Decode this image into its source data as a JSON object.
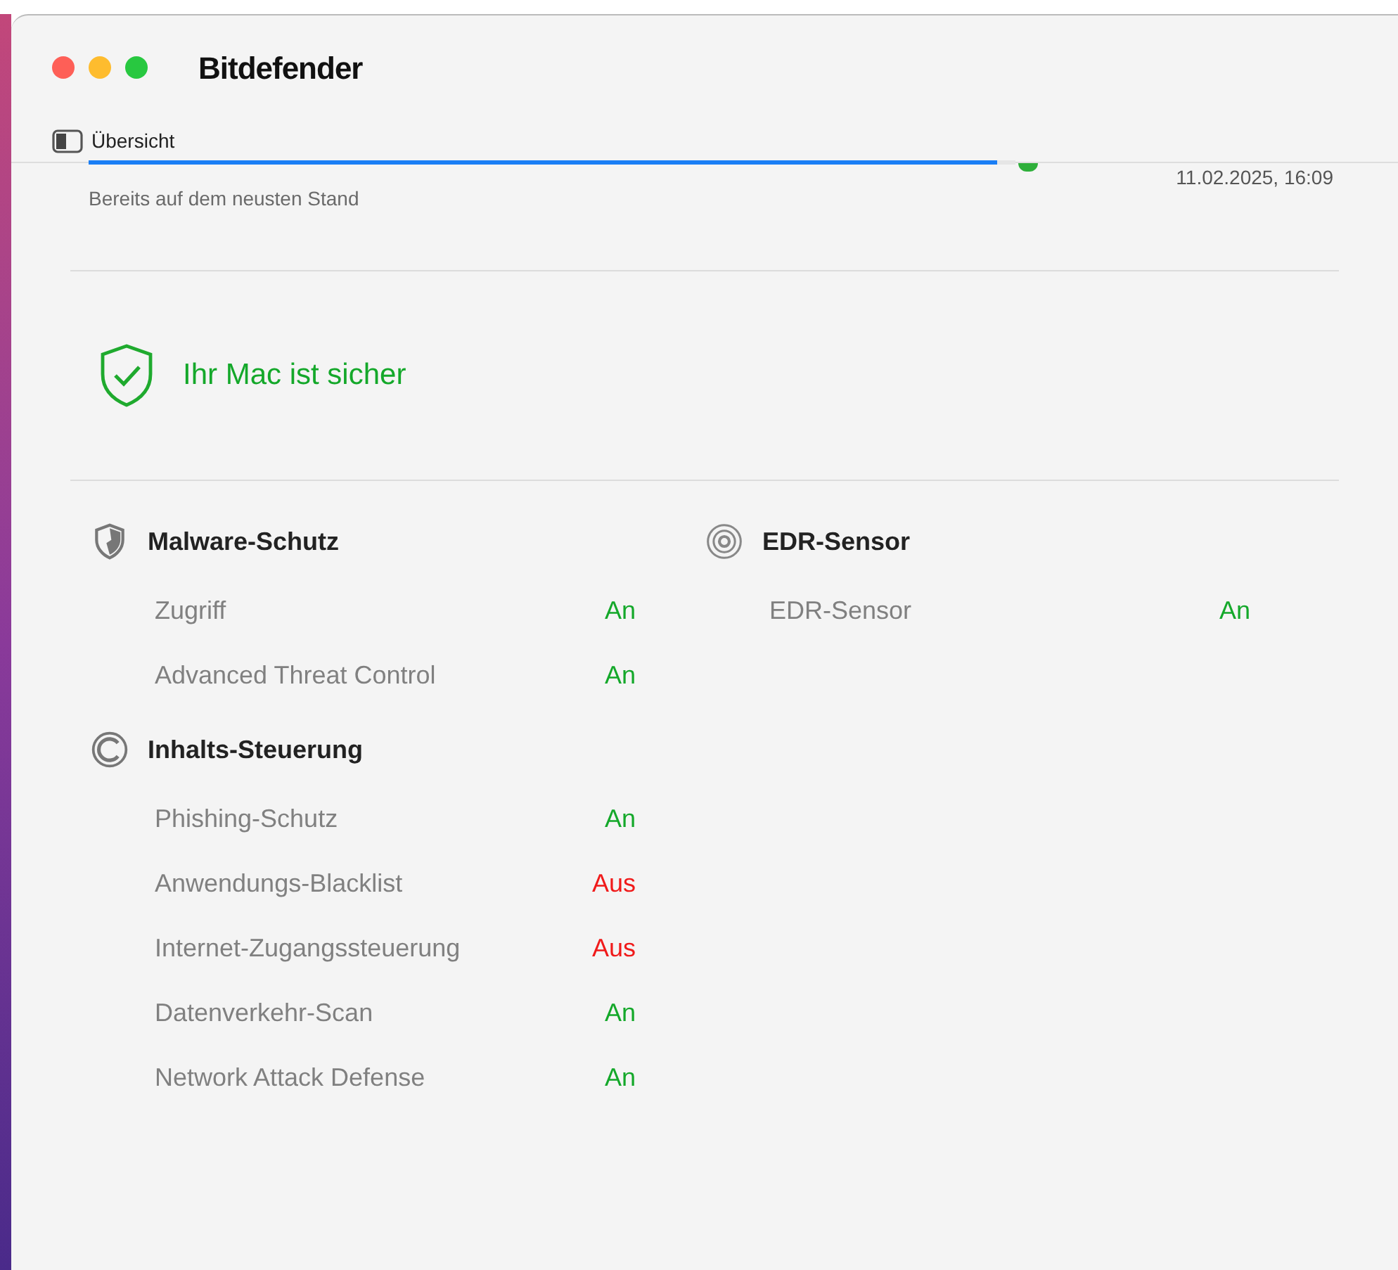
{
  "window": {
    "title": "Bitdefender"
  },
  "toolbar": {
    "label": "Übersicht"
  },
  "update": {
    "level": 0.98,
    "date": "11.02.2025, 16:09",
    "status": "Bereits auf dem neusten Stand"
  },
  "summary": {
    "text": "Ihr Mac ist sicher"
  },
  "columns": [
    {
      "groups": [
        {
          "kind": "shield",
          "title": "Malware-Schutz",
          "items": [
            {
              "name": "Zugriff",
              "state": "An",
              "on": true
            },
            {
              "name": "Advanced Threat Control",
              "state": "An",
              "on": true
            }
          ]
        },
        {
          "kind": "content",
          "title": "Inhalts-Steuerung",
          "items": [
            {
              "name": "Phishing-Schutz",
              "state": "An",
              "on": true
            },
            {
              "name": "Anwendungs-Blacklist",
              "state": "Aus",
              "on": false
            },
            {
              "name": "Internet-Zugangssteuerung",
              "state": "Aus",
              "on": false
            },
            {
              "name": "Datenverkehr-Scan",
              "state": "An",
              "on": true
            },
            {
              "name": "Network Attack Defense",
              "state": "An",
              "on": true
            }
          ]
        }
      ]
    },
    {
      "groups": [
        {
          "kind": "sensor",
          "title": "EDR-Sensor",
          "items": [
            {
              "name": "EDR-Sensor",
              "state": "An",
              "on": true
            }
          ]
        }
      ]
    }
  ]
}
